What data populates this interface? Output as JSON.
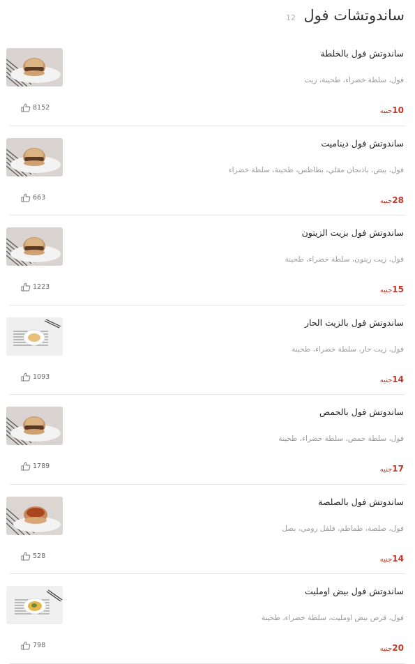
{
  "header": {
    "title": "ساندوتشات فول",
    "count": "12"
  },
  "items": [
    {
      "name": "ساندوتش فول بالخلطة",
      "desc": "فول، سلطة خضراء، طحينة، زيت",
      "price": "10",
      "currency": "جنيه",
      "likes": "8152",
      "photo": "sandwich-bun"
    },
    {
      "name": "ساندوتش فول ديناميت",
      "desc": "فول، بيض، باذنجان مقلي، بطاطس، طحينة، سلطة خضراء",
      "price": "28",
      "currency": "جنيه",
      "likes": "663",
      "photo": "sandwich-bun"
    },
    {
      "name": "ساندوتش فول بزيت الزيتون",
      "desc": "فول، زيت زيتون، سلطة خضراء، طحينة",
      "price": "15",
      "currency": "جنيه",
      "likes": "1223",
      "photo": "sandwich-bun"
    },
    {
      "name": "ساندوتش فول بالزيت الحار",
      "desc": "فول، زيت حار، سلطة خضراء، طحينة",
      "price": "14",
      "currency": "جنيه",
      "likes": "1093",
      "photo": "plate-top"
    },
    {
      "name": "ساندوتش فول بالحمص",
      "desc": "فول، سلطة حمص، سلطة خضراء، طحينة",
      "price": "17",
      "currency": "جنيه",
      "likes": "1789",
      "photo": "sandwich-bun"
    },
    {
      "name": "ساندوتش فول بالصلصة",
      "desc": "فول، صلصة، طماطم، فلفل رومي، بصل",
      "price": "14",
      "currency": "جنيه",
      "likes": "528",
      "photo": "sandwich-open"
    },
    {
      "name": "ساندوتش فول بيض اومليت",
      "desc": "فول، قرص بيض اومليت، سلطة خضراء، طحينة",
      "price": "20",
      "currency": "جنيه",
      "likes": "798",
      "photo": "plate-omelet"
    }
  ],
  "colors": {
    "price": "#c0392b",
    "divider": "#e6e6e6",
    "muted": "#9a9a9a"
  },
  "icons": {
    "likes": "thumbs-up-icon"
  }
}
